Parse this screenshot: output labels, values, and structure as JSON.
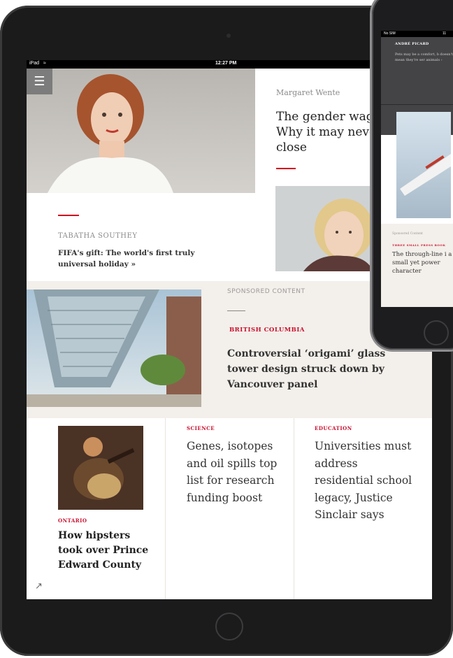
{
  "ipad": {
    "status": {
      "carrier": "iPad",
      "time": "12:27 PM"
    },
    "menu_icon": "hamburger-icon",
    "top_story": {
      "byline": "Margaret Wente",
      "headline": "The gender wage Why it may neve close"
    },
    "southey": {
      "byline": "TABATHA SOUTHEY",
      "headline": "FIFA's gift: The world's first truly universal holiday »"
    },
    "sponsored": {
      "label": "SPONSORED CONTENT",
      "kicker": "BRITISH COLUMBIA",
      "headline": "Controversial ‘origami’ glass tower design struck down by Vancouver panel"
    },
    "bottom": [
      {
        "kicker": "ONTARIO",
        "headline": "How hipsters took over Prince Edward County"
      },
      {
        "kicker": "SCIENCE",
        "headline": "Genes, isotopes and oil spills top list for research funding boost"
      },
      {
        "kicker": "EDUCATION",
        "headline": "Universities must address residential school legacy, Justice Sinclair says"
      }
    ],
    "trend_icon": "trending-icon"
  },
  "phone": {
    "status": {
      "carrier": "No SIM",
      "time": "11"
    },
    "byline": "ANDRÉ PICARD",
    "teaser": "Pets may be a comfort, b doesn't mean they're ser animals ›",
    "sponsored_label": "Sponsored Content",
    "kicker": "THREE SMALL PRESS BOOK",
    "headline": "The through-line i a small yet power character"
  },
  "colors": {
    "accent": "#c8102e",
    "band": "#f3efea",
    "device": "#1b1b1c"
  }
}
